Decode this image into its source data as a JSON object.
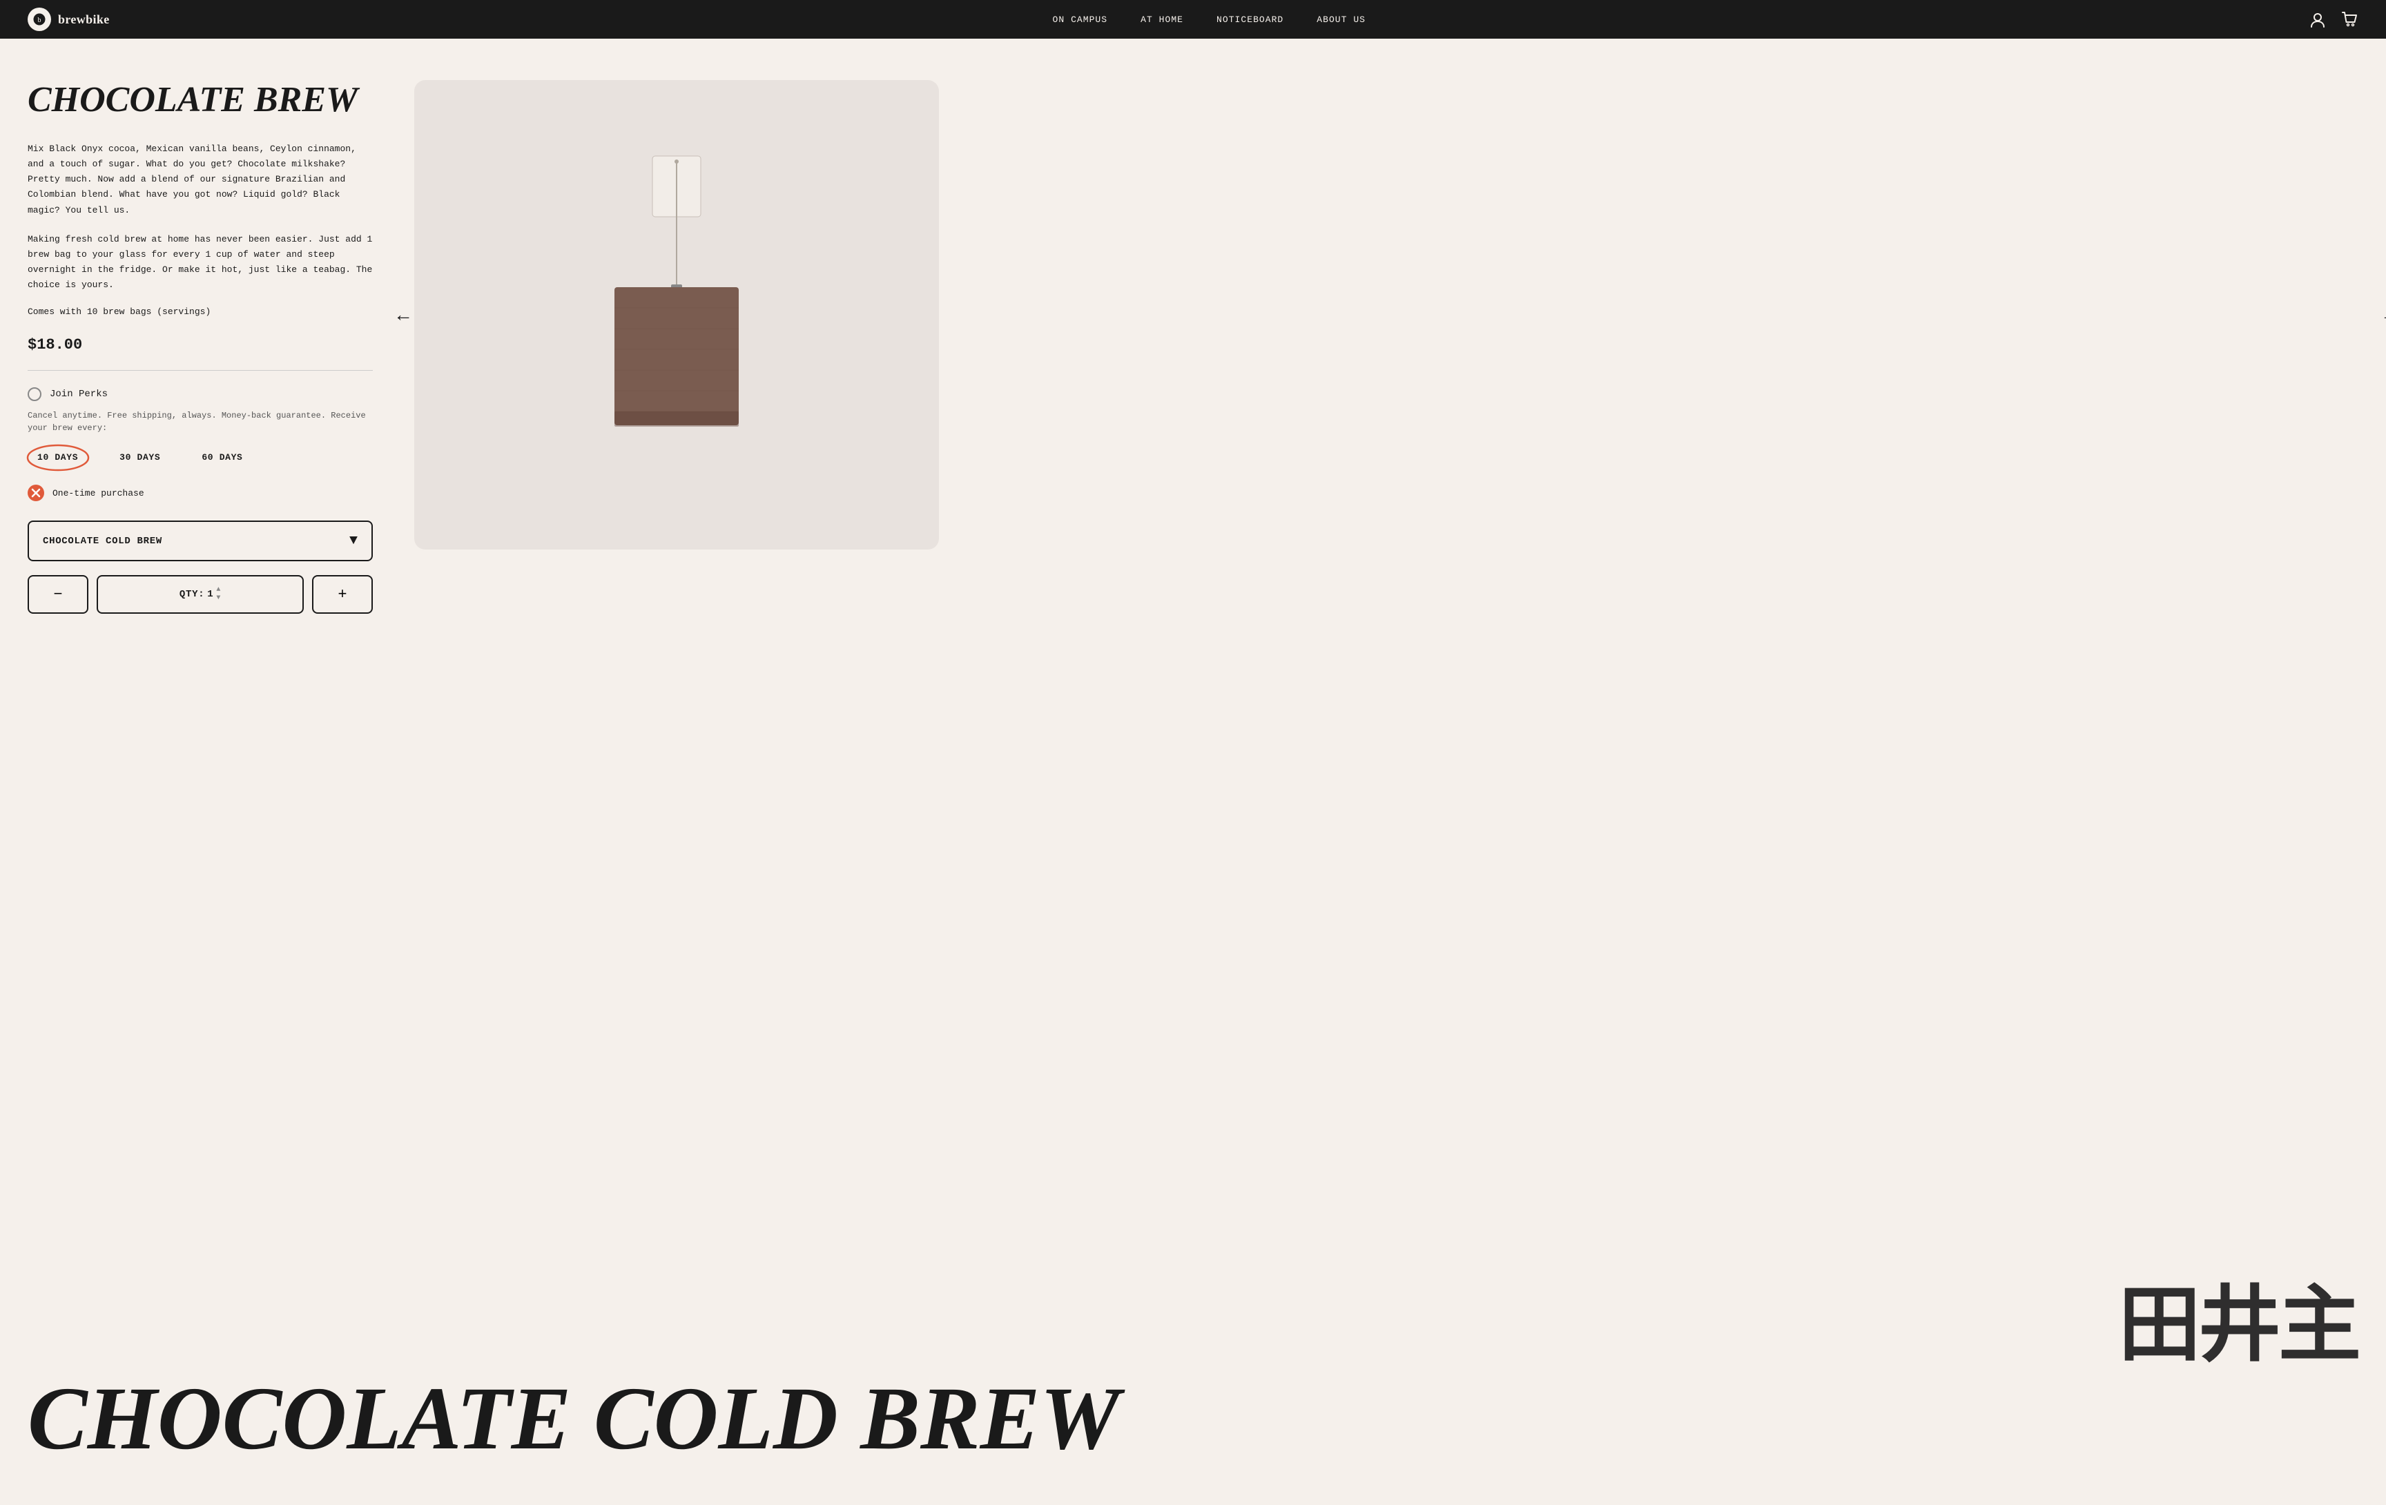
{
  "nav": {
    "logo_text": "brewbike",
    "links": [
      {
        "label": "ON CAMPUS",
        "href": "#",
        "active": false
      },
      {
        "label": "AT HOME",
        "href": "#",
        "active": true
      },
      {
        "label": "NOTICEBOARD",
        "href": "#",
        "active": false
      },
      {
        "label": "ABOUT US",
        "href": "#",
        "active": false
      }
    ]
  },
  "product": {
    "title": "CHOCOLATE BREW",
    "description_1": "Mix Black Onyx cocoa, Mexican vanilla beans, Ceylon cinnamon, and a touch of sugar. What do you get? Chocolate milkshake? Pretty much. Now add a blend of our signature Brazilian and Colombian blend. What have you got now? Liquid gold? Black magic? You tell us.",
    "description_2": "Making fresh cold brew at home has never been easier. Just add 1 brew bag to your glass for every 1 cup of water and steep overnight in the fridge. Or make it hot, just like a teabag. The choice is yours.",
    "servings": "Comes with 10 brew bags (servings)",
    "price": "$18.00",
    "perks_label": "Join Perks",
    "perks_sublabel": "Cancel anytime. Free shipping, always. Money-back guarantee. Receive your brew every:",
    "days_options": [
      {
        "label": "10 DAYS",
        "selected": true
      },
      {
        "label": "30 DAYS",
        "selected": false
      },
      {
        "label": "60 DAYS",
        "selected": false
      }
    ],
    "one_time_label": "One-time purchase",
    "dropdown_label": "CHOCOLATE COLD BREW",
    "qty_label": "QTY:",
    "qty_value": "1",
    "qty_minus": "−",
    "qty_plus": "+"
  },
  "bottom_title": "CHOCOLATE COLD BREW",
  "nav_arrow_left": "←",
  "nav_arrow_right": "→"
}
